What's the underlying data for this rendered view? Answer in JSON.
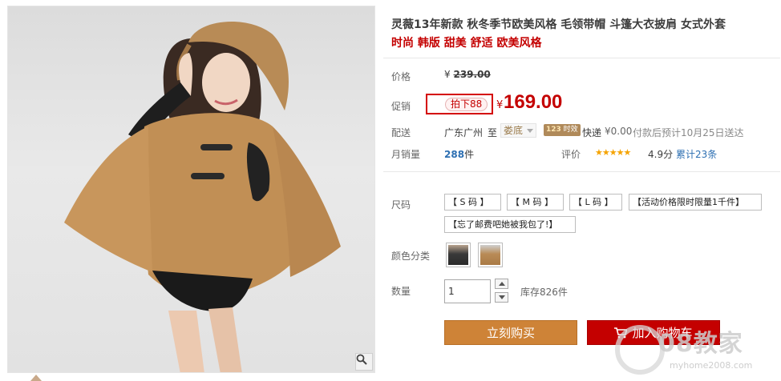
{
  "product": {
    "title": "灵薇13年新款 秋冬季节欧美风格 毛领带帽 斗篷大衣披肩 女式外套",
    "subtitle": "时尚 韩版 甜美 舒适 欧美风格"
  },
  "price": {
    "label": "价格",
    "currency": "¥",
    "original": "239.00"
  },
  "promo": {
    "label": "促销",
    "tag": "拍下88",
    "currency": "¥",
    "price": "169.00"
  },
  "shipping": {
    "label": "配送",
    "from": "广东广州",
    "to_sep": "至",
    "destination": "娄底",
    "badge_number": "123",
    "badge_text": "时效",
    "method": "快递",
    "fee": "¥0.00",
    "note": "付款后预计10月25日送达"
  },
  "sales": {
    "label": "月销量",
    "count": "288",
    "unit": "件",
    "rating_label": "评价",
    "stars": "★★★★★",
    "score": "4.9分",
    "review_count": "累计23条"
  },
  "size": {
    "label": "尺码",
    "options": [
      "【 S 码 】",
      "【 M 码 】",
      "【 L 码 】",
      "【活动价格限时限量1千件】",
      "【忘了邮费吧她被我包了!】"
    ]
  },
  "color": {
    "label": "颜色分类"
  },
  "quantity": {
    "label": "数量",
    "value": "1",
    "stock": "库存826件"
  },
  "actions": {
    "buy_now": "立刻购买",
    "add_to_cart": "加入购物车"
  },
  "watermark": {
    "text": "08教家",
    "url": "myhome2008.com"
  },
  "icons": {
    "zoom": "magnifier-icon",
    "cart": "cart-icon",
    "stepper_up": "chevron-up-icon",
    "stepper_down": "chevron-down-icon"
  },
  "colors": {
    "accent_red": "#c40000",
    "buy_orange": "#ce8337",
    "link_blue": "#2d6fb2",
    "star_orange": "#f5a300"
  }
}
